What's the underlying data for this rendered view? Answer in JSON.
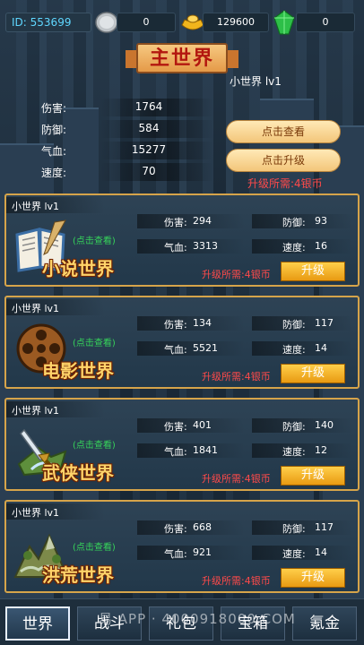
{
  "top_bar": {
    "id_label": "ID:",
    "id_value": "553699",
    "silver": "0",
    "gold": "129600",
    "gem": "0"
  },
  "main_world": {
    "title": "主世界",
    "level": "小世界 lv1",
    "stats": [
      {
        "label": "伤害:",
        "value": "1764"
      },
      {
        "label": "防御:",
        "value": "584"
      },
      {
        "label": "气血:",
        "value": "15277"
      },
      {
        "label": "速度:",
        "value": "70"
      }
    ],
    "view_button": "点击查看",
    "upgrade_button": "点击升级",
    "upgrade_need": "升级所需:4银币"
  },
  "worlds": [
    {
      "level": "小世界 lv1",
      "click": "(点击查看)",
      "name": "小说世界",
      "damage_label": "伤害:",
      "damage": "294",
      "defense_label": "防御:",
      "defense": "93",
      "hp_label": "气血:",
      "hp": "3313",
      "speed_label": "速度:",
      "speed": "16",
      "need": "升级所需:4银币",
      "upgrade": "升级"
    },
    {
      "level": "小世界 lv1",
      "click": "(点击查看)",
      "name": "电影世界",
      "damage_label": "伤害:",
      "damage": "134",
      "defense_label": "防御:",
      "defense": "117",
      "hp_label": "气血:",
      "hp": "5521",
      "speed_label": "速度:",
      "speed": "14",
      "need": "升级所需:4银币",
      "upgrade": "升级"
    },
    {
      "level": "小世界 lv1",
      "click": "(点击查看)",
      "name": "武侠世界",
      "damage_label": "伤害:",
      "damage": "401",
      "defense_label": "防御:",
      "defense": "140",
      "hp_label": "气血:",
      "hp": "1841",
      "speed_label": "速度:",
      "speed": "12",
      "need": "升级所需:4银币",
      "upgrade": "升级"
    },
    {
      "level": "小世界 lv1",
      "click": "(点击查看)",
      "name": "洪荒世界",
      "damage_label": "伤害:",
      "damage": "668",
      "defense_label": "防御:",
      "defense": "117",
      "hp_label": "气血:",
      "hp": "921",
      "speed_label": "速度:",
      "speed": "14",
      "need": "升级所需:4银币",
      "upgrade": "升级"
    }
  ],
  "tabs": [
    {
      "label": "世界",
      "active": true
    },
    {
      "label": "战斗",
      "active": false
    },
    {
      "label": "礼包",
      "active": false
    },
    {
      "label": "宝箱",
      "active": false
    },
    {
      "label": "氪金",
      "active": false
    }
  ],
  "watermark": "易 APP · 4000918000.COM",
  "icons": {
    "silver": "silver-coin-icon",
    "gold": "gold-ingot-icon",
    "gem": "green-gem-icon",
    "world_1": "book-icon",
    "world_2": "film-reel-icon",
    "world_3": "sword-icon",
    "world_4": "mountain-icon"
  },
  "colors": {
    "accent_gold": "#d6a44a",
    "warning_red": "#ff4a4a",
    "link_green": "#36d45a",
    "id_cyan": "#5fd7ff"
  }
}
